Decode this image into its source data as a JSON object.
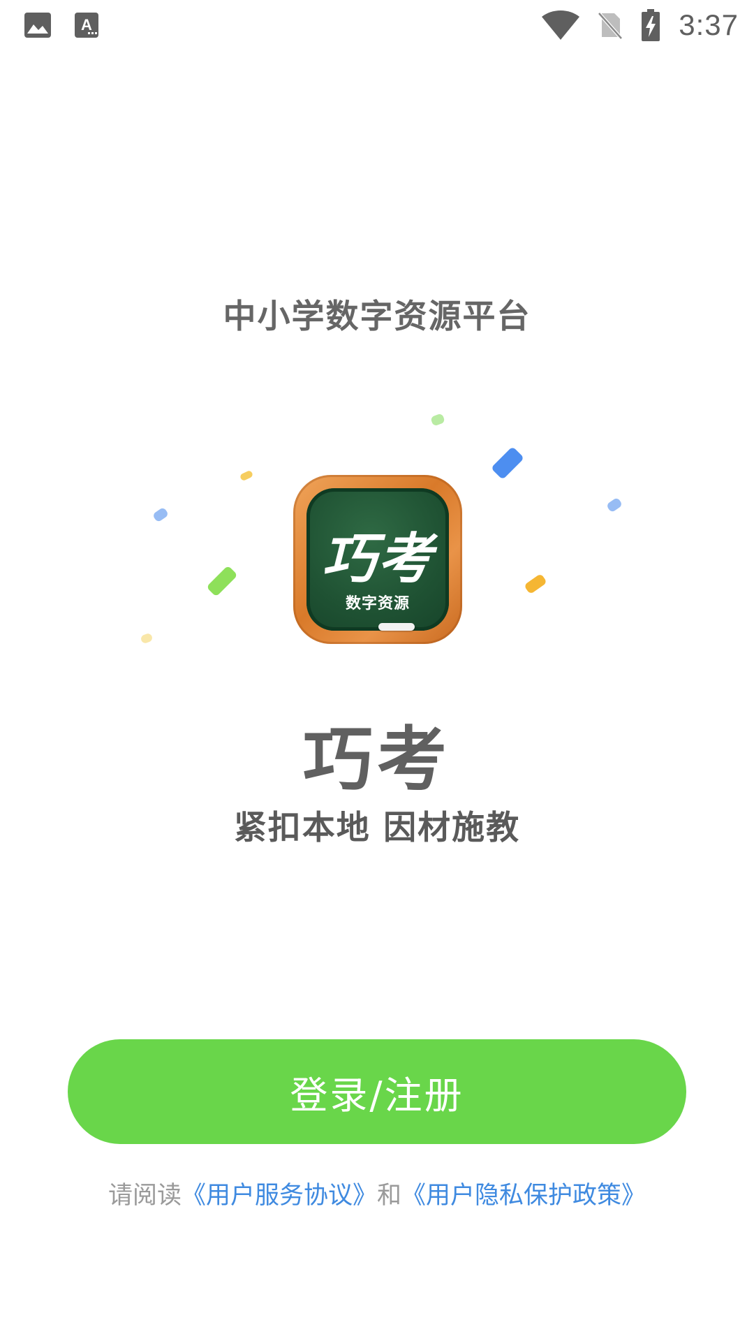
{
  "status_bar": {
    "left_icons": [
      "image-icon",
      "text-a-icon"
    ],
    "right_icons": [
      "wifi-icon",
      "no-sim-icon",
      "battery-charging-icon"
    ],
    "time": "3:37"
  },
  "main": {
    "platform_title": "中小学数字资源平台",
    "logo": {
      "title": "巧考",
      "subtitle": "数字资源",
      "frame_color": "#e08a3a",
      "board_color": "#1f5233"
    },
    "app_name": "巧考",
    "slogan": "紧扣本地 因材施教",
    "login_button_label": "登录/注册",
    "accent_color": "#69d64a",
    "agreement": {
      "prefix": "请阅读",
      "service_link": "《用户服务协议》",
      "conjunction": "和",
      "privacy_link": "《用户隐私保护政策》",
      "link_color": "#3f8ae0"
    }
  }
}
